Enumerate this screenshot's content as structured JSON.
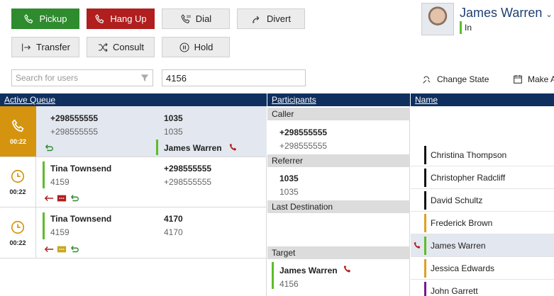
{
  "toolbar": {
    "pickup": "Pickup",
    "hangup": "Hang Up",
    "dial": "Dial",
    "divert": "Divert",
    "transfer": "Transfer",
    "consult": "Consult",
    "hold": "Hold"
  },
  "search": {
    "placeholder": "Search for users",
    "number_value": "4156"
  },
  "headers": {
    "active_queue": "Active Queue",
    "participants": "Participants",
    "name": "Name"
  },
  "queue": [
    {
      "time": "00:22",
      "caller": "+298555555",
      "caller_sub": "+298555555",
      "callee": "1035",
      "callee_sub": "1035",
      "agent": "James Warren"
    },
    {
      "time": "00:22",
      "caller": "Tina Townsend",
      "caller_sub": "4159",
      "callee": "+298555555",
      "callee_sub": "+298555555"
    },
    {
      "time": "00:22",
      "caller": "Tina Townsend",
      "caller_sub": "4159",
      "callee": "4170",
      "callee_sub": "4170"
    }
  ],
  "participants": {
    "caller_label": "Caller",
    "caller": "+298555555",
    "caller_sub": "+298555555",
    "referrer_label": "Referrer",
    "referrer": "1035",
    "referrer_sub": "1035",
    "last_dest_label": "Last Destination",
    "target_label": "Target",
    "target": "James Warren",
    "target_sub": "4156"
  },
  "user": {
    "name": "James Warren",
    "state": "In"
  },
  "actions": {
    "change_state": "Change State",
    "make": "Make A"
  },
  "users": [
    {
      "name": "Christina Thompson",
      "color": "#111111"
    },
    {
      "name": "Christopher Radcliff",
      "color": "#111111"
    },
    {
      "name": "David Schultz",
      "color": "#111111"
    },
    {
      "name": "Frederick Brown",
      "color": "#e0a020"
    },
    {
      "name": "James Warren",
      "color": "#5cbd2b"
    },
    {
      "name": "Jessica Edwards",
      "color": "#e0a020"
    },
    {
      "name": "John Garrett",
      "color": "#7a1a8a"
    }
  ]
}
